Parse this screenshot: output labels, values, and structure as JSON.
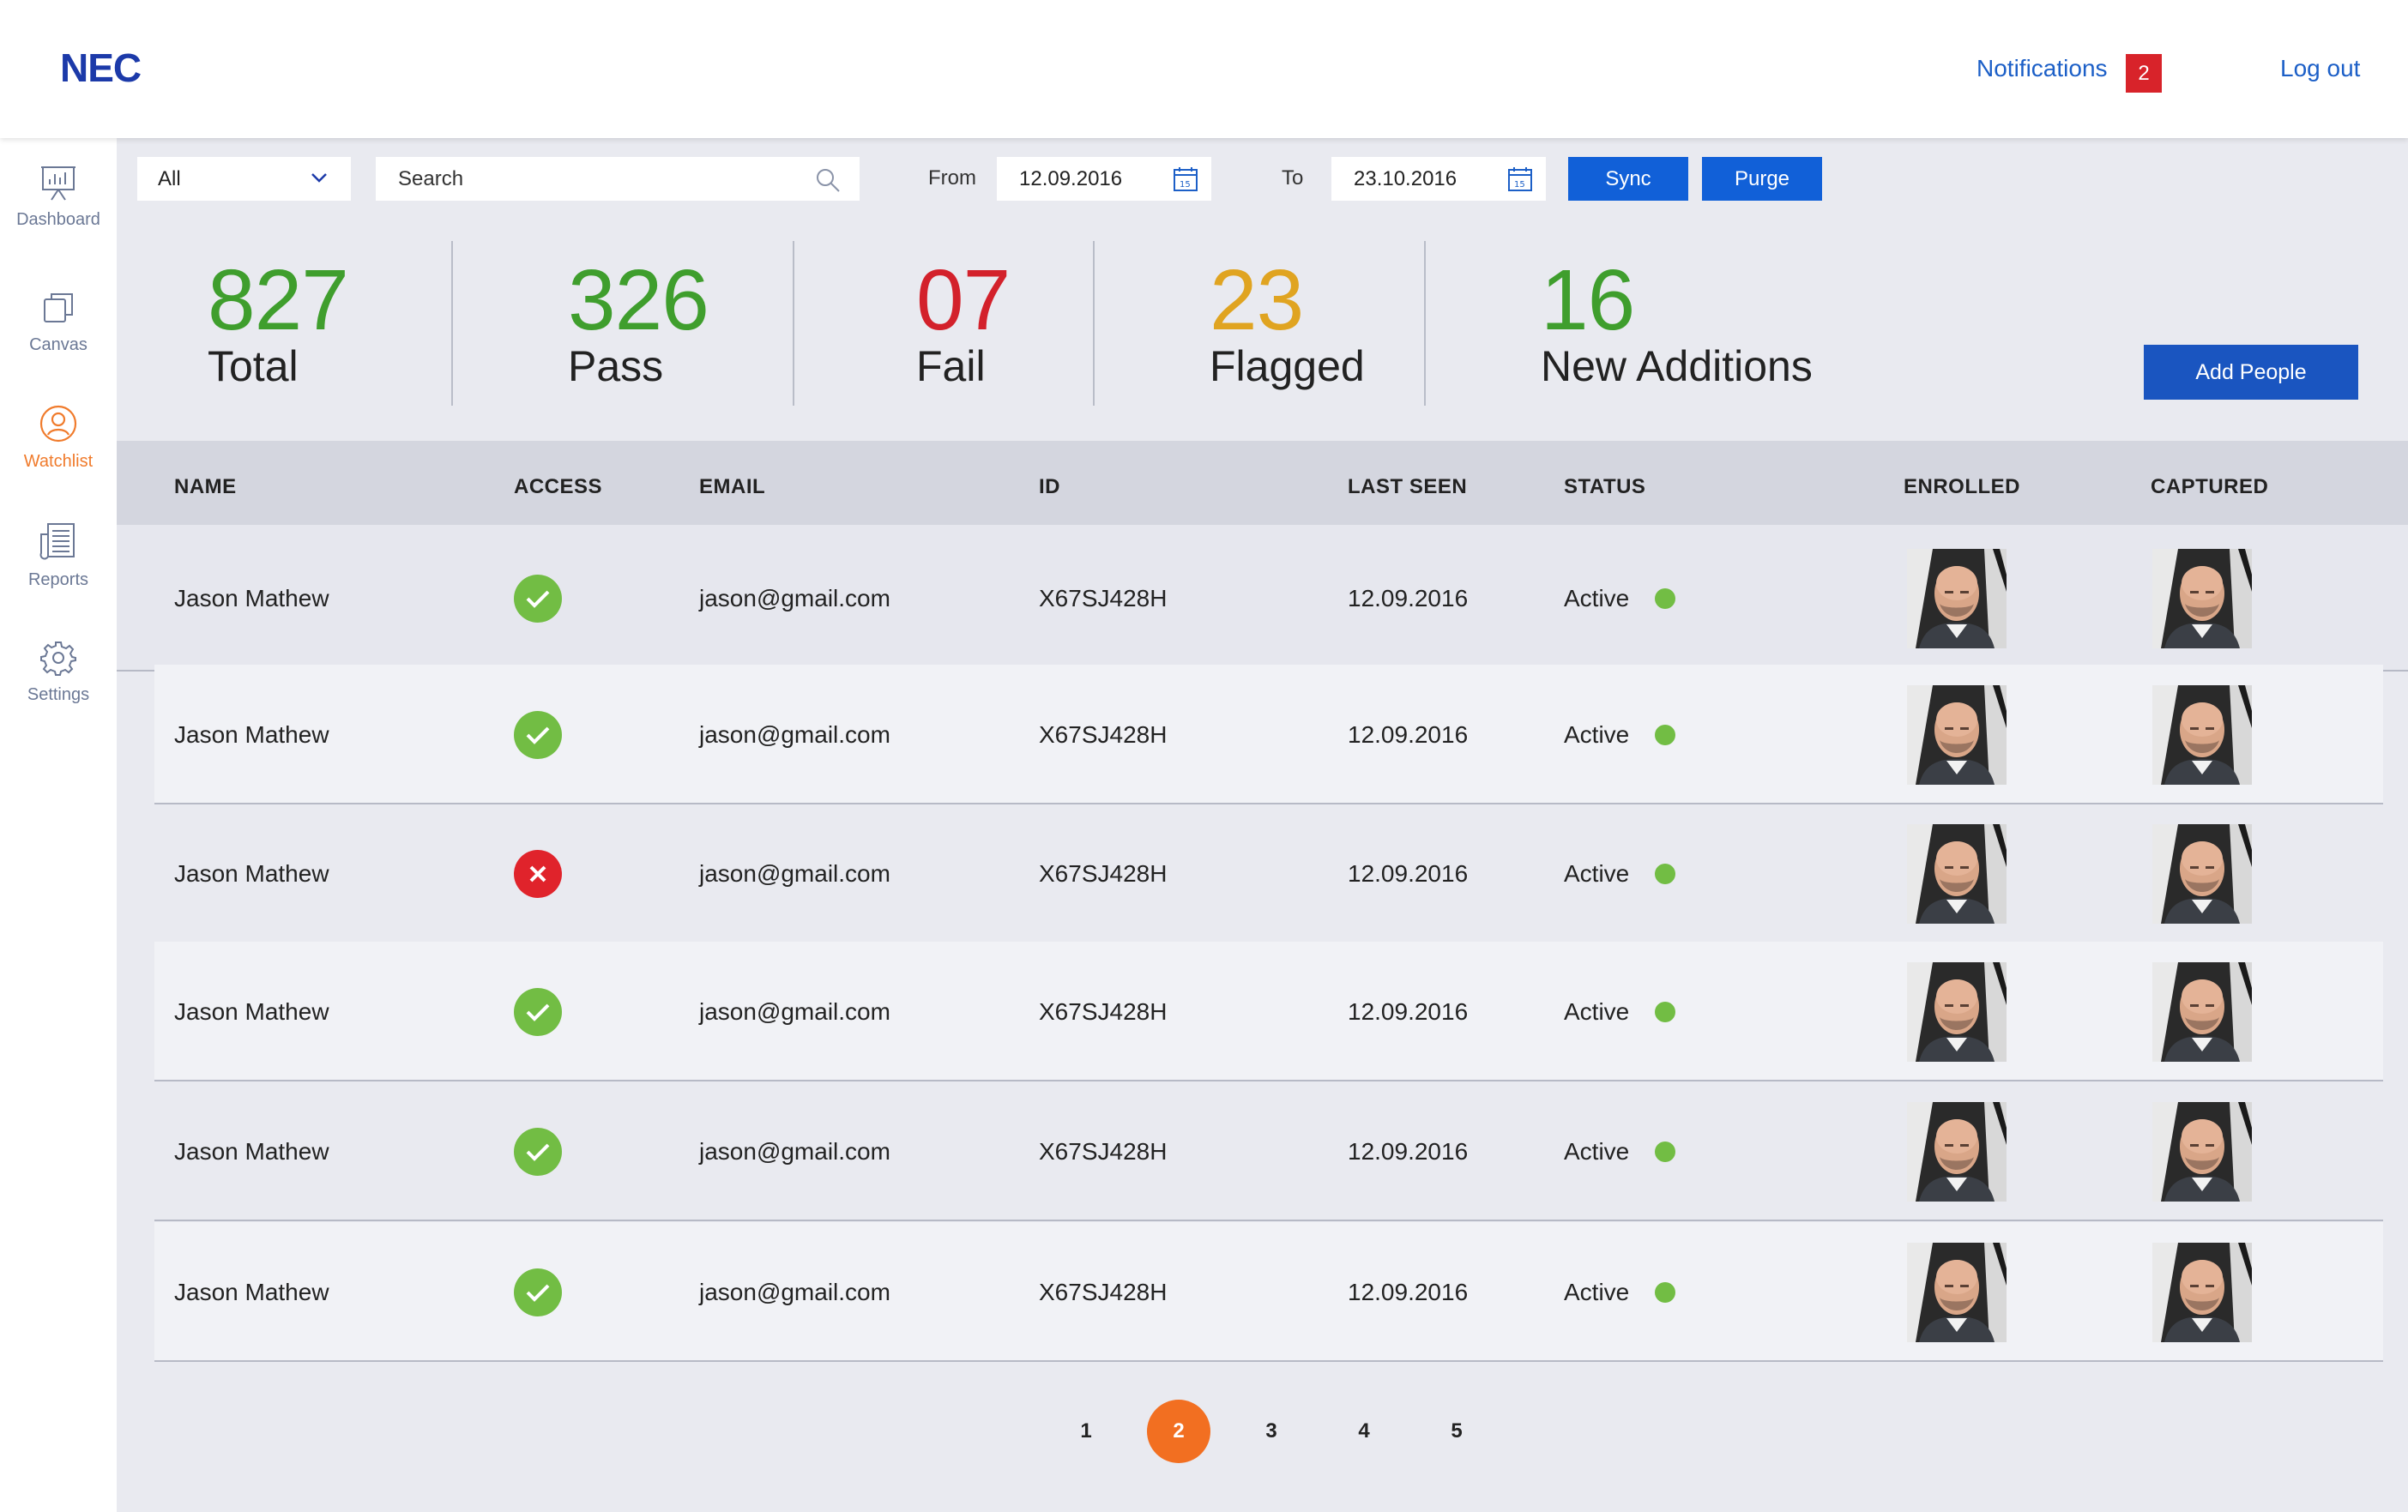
{
  "brand": {
    "logo_text": "NEC"
  },
  "header": {
    "notifications_label": "Notifications",
    "notifications_count": "2",
    "logout_label": "Log out"
  },
  "sidebar": {
    "items": [
      {
        "label": "Dashboard",
        "icon": "dashboard-icon",
        "active": false
      },
      {
        "label": "Canvas",
        "icon": "canvas-icon",
        "active": false
      },
      {
        "label": "Watchlist",
        "icon": "watchlist-icon",
        "active": true
      },
      {
        "label": "Reports",
        "icon": "reports-icon",
        "active": false
      },
      {
        "label": "Settings",
        "icon": "gear-icon",
        "active": false
      }
    ]
  },
  "toolbar": {
    "filter_value": "All",
    "search_placeholder": "Search",
    "from_label": "From",
    "from_date": "12.09.2016",
    "to_label": "To",
    "to_date": "23.10.2016",
    "sync_label": "Sync",
    "purge_label": "Purge"
  },
  "stats": [
    {
      "value": "827",
      "label": "Total",
      "color": "#3f9e2d"
    },
    {
      "value": "326",
      "label": "Pass",
      "color": "#3f9e2d"
    },
    {
      "value": "07",
      "label": "Fail",
      "color": "#d3212b"
    },
    {
      "value": "23",
      "label": "Flagged",
      "color": "#e0a421"
    },
    {
      "value": "16",
      "label": "New Additions",
      "color": "#3f9e2d"
    }
  ],
  "add_people_label": "Add People",
  "table": {
    "columns": [
      "NAME",
      "ACCESS",
      "EMAIL",
      "ID",
      "LAST SEEN",
      "STATUS",
      "ENROLLED",
      "CAPTURED"
    ],
    "rows": [
      {
        "name": "Jason Mathew",
        "access": "pass",
        "email": "jason@gmail.com",
        "id": "X67SJ428H",
        "last_seen": "12.09.2016",
        "status": "Active"
      },
      {
        "name": "Jason Mathew",
        "access": "pass",
        "email": "jason@gmail.com",
        "id": "X67SJ428H",
        "last_seen": "12.09.2016",
        "status": "Active"
      },
      {
        "name": "Jason Mathew",
        "access": "fail",
        "email": "jason@gmail.com",
        "id": "X67SJ428H",
        "last_seen": "12.09.2016",
        "status": "Active"
      },
      {
        "name": "Jason Mathew",
        "access": "pass",
        "email": "jason@gmail.com",
        "id": "X67SJ428H",
        "last_seen": "12.09.2016",
        "status": "Active"
      },
      {
        "name": "Jason Mathew",
        "access": "pass",
        "email": "jason@gmail.com",
        "id": "X67SJ428H",
        "last_seen": "12.09.2016",
        "status": "Active"
      },
      {
        "name": "Jason Mathew",
        "access": "pass",
        "email": "jason@gmail.com",
        "id": "X67SJ428H",
        "last_seen": "12.09.2016",
        "status": "Active"
      }
    ]
  },
  "pagination": {
    "pages": [
      "1",
      "2",
      "3",
      "4",
      "5"
    ],
    "current": "2"
  },
  "colors": {
    "accent": "#1160d8",
    "active": "#f07b2c",
    "pass": "#72bd44",
    "fail": "#e0232b"
  }
}
